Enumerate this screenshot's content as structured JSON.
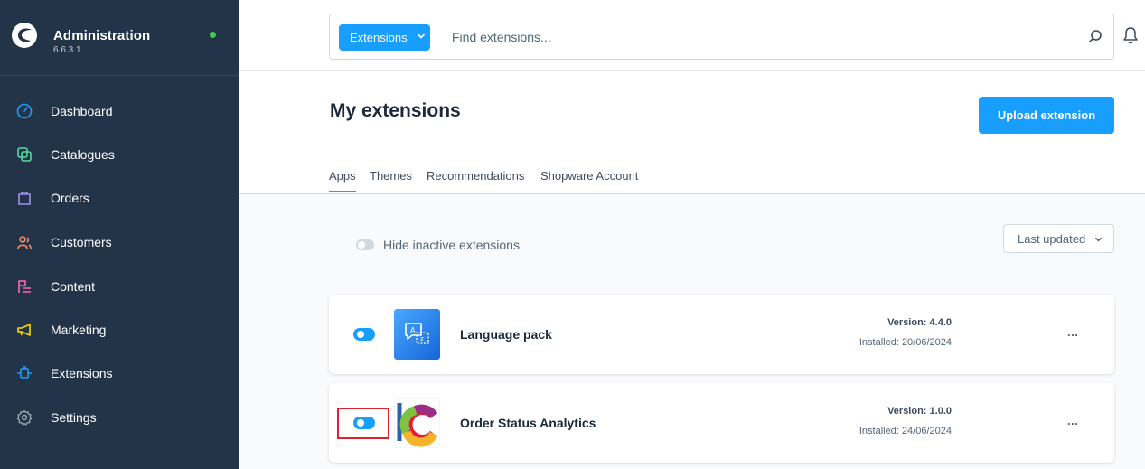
{
  "sidebar": {
    "brand_title": "Administration",
    "brand_version": "6.6.3.1",
    "status_color": "#37d046",
    "items": [
      {
        "label": "Dashboard",
        "icon": "dashboard-icon",
        "color": "#189eff"
      },
      {
        "label": "Catalogues",
        "icon": "catalogues-icon",
        "color": "#57d9a3"
      },
      {
        "label": "Orders",
        "icon": "orders-icon",
        "color": "#a092f0"
      },
      {
        "label": "Customers",
        "icon": "customers-icon",
        "color": "#f88962"
      },
      {
        "label": "Content",
        "icon": "content-icon",
        "color": "#ff68b4"
      },
      {
        "label": "Marketing",
        "icon": "marketing-icon",
        "color": "#ffd700"
      },
      {
        "label": "Extensions",
        "icon": "extensions-icon",
        "color": "#189eff"
      },
      {
        "label": "Settings",
        "icon": "settings-icon",
        "color": "#9aa8b5"
      }
    ]
  },
  "search": {
    "scope_label": "Extensions",
    "placeholder": "Find extensions..."
  },
  "page": {
    "title": "My extensions",
    "upload_label": "Upload extension"
  },
  "tabs": [
    {
      "label": "Apps",
      "active": true
    },
    {
      "label": "Themes",
      "active": false
    },
    {
      "label": "Recommendations",
      "active": false
    },
    {
      "label": "Shopware Account",
      "active": false
    }
  ],
  "filters": {
    "hide_inactive_label": "Hide inactive extensions",
    "hide_inactive_on": false,
    "sort_label": "Last updated"
  },
  "extensions": [
    {
      "name": "Language pack",
      "version": "Version: 4.4.0",
      "installed": "Installed: 20/06/2024",
      "active": true,
      "icon": "language-pack-icon"
    },
    {
      "name": "Order Status Analytics",
      "version": "Version: 1.0.0",
      "installed": "Installed: 24/06/2024",
      "active": true,
      "icon": "order-status-analytics-icon"
    }
  ],
  "more_label": "...",
  "colors": {
    "accent": "#189eff",
    "sidebar_bg": "#243448",
    "highlight": "#e02032"
  }
}
